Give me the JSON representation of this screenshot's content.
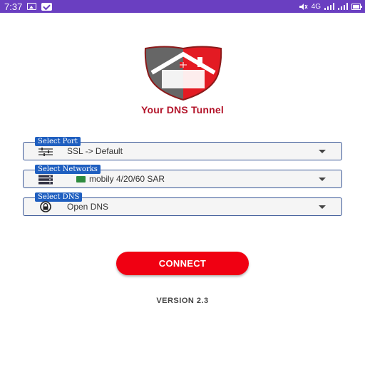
{
  "status_bar": {
    "time": "7:37",
    "network_type": "4G",
    "background_color": "#6a3fc1",
    "icons": [
      "image-icon",
      "mail-icon",
      "mute-icon",
      "signal-icon",
      "battery-icon"
    ]
  },
  "app": {
    "title": "Your DNS Tunnel",
    "title_color": "#b3142a",
    "logo_colors": {
      "left": "#666666",
      "right": "#e31b23",
      "outline": "#8b1a1a"
    }
  },
  "fields": {
    "port": {
      "label": "Select Port",
      "value": "SSL -> Default",
      "icon": "sliders-icon"
    },
    "network": {
      "label": "Select Networks",
      "value": "mobily 4/20/60 SAR",
      "icon": "server-icon",
      "flag": "saudi-flag-icon"
    },
    "dns": {
      "label": "Select DNS",
      "value": "Open DNS",
      "icon": "lock-icon"
    },
    "label_color": "#1f5fc0"
  },
  "connect_button": {
    "label": "CONNECT",
    "color": "#f00012"
  },
  "version": "VERSION 2.3"
}
